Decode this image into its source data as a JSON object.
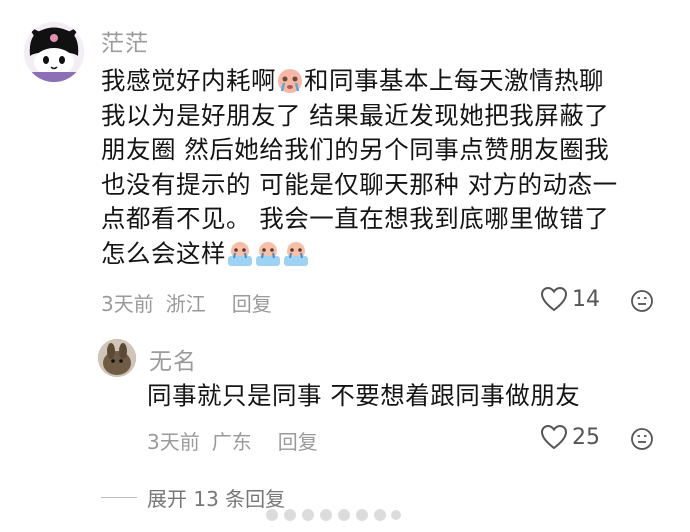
{
  "comment": {
    "username": "茫茫",
    "lines": [
      [
        "我感觉好内耗啊",
        "和同事基本上每天激情热聊"
      ],
      [
        "我以为是好朋友了 结果最近发现她把我屏蔽了"
      ],
      [
        "朋友圈 然后她给我们的另个同事点赞朋友圈我"
      ],
      [
        "也没有提示的 可能是仅聊天那种 对方的动态一"
      ],
      [
        "点都看不见。 我会一直在想我到底哪里做错了"
      ],
      [
        "怎么会这样",
        ""
      ]
    ],
    "time": "3天前",
    "location": "浙江",
    "reply_label": "回复",
    "likes": "14"
  },
  "reply": {
    "username": "无名",
    "text": "同事就只是同事 不要想着跟同事做朋友",
    "time": "3天前",
    "location": "广东",
    "reply_label": "回复",
    "likes": "25"
  },
  "expand_label": "展开 13 条回复",
  "colors": {
    "meta": "#9a9a9a",
    "text": "#141414",
    "background": "#ffffff"
  }
}
